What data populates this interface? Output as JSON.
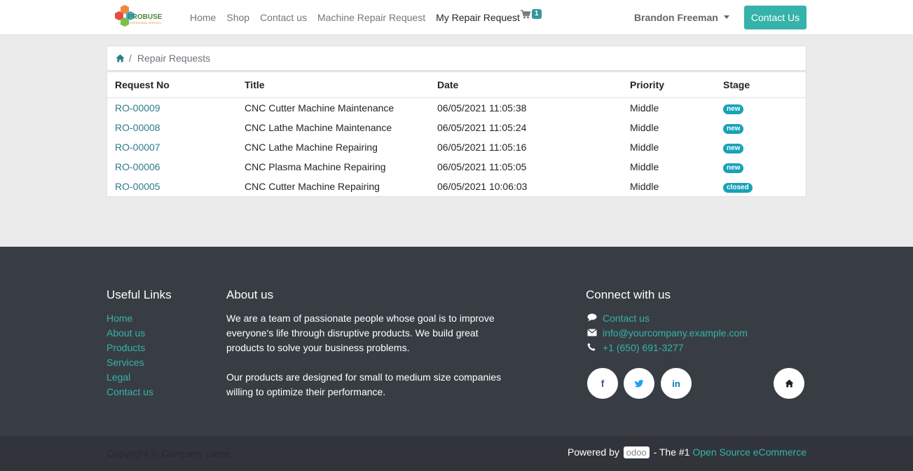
{
  "brand": {
    "name": "PROBUSE",
    "tagline": "PROFESSIONAL SERVICES"
  },
  "nav": {
    "items": [
      "Home",
      "Shop",
      "Contact us",
      "Machine Repair Request",
      "My Repair Request"
    ],
    "cart_count": "1",
    "user": "Brandon Freeman",
    "contact_button": "Contact Us"
  },
  "breadcrumb": {
    "current": "Repair Requests"
  },
  "table": {
    "headers": [
      "Request No",
      "Title",
      "Date",
      "Priority",
      "Stage"
    ],
    "rows": [
      {
        "no": "RO-00009",
        "title": "CNC Cutter Machine Maintenance",
        "date": "06/05/2021 11:05:38",
        "priority": "Middle",
        "stage": "new"
      },
      {
        "no": "RO-00008",
        "title": "CNC Lathe Machine Maintenance",
        "date": "06/05/2021 11:05:24",
        "priority": "Middle",
        "stage": "new"
      },
      {
        "no": "RO-00007",
        "title": "CNC Lathe Machine Repairing",
        "date": "06/05/2021 11:05:16",
        "priority": "Middle",
        "stage": "new"
      },
      {
        "no": "RO-00006",
        "title": "CNC Plasma Machine Repairing",
        "date": "06/05/2021 11:05:05",
        "priority": "Middle",
        "stage": "new"
      },
      {
        "no": "RO-00005",
        "title": "CNC Cutter Machine Repairing",
        "date": "06/05/2021 10:06:03",
        "priority": "Middle",
        "stage": "closed"
      }
    ]
  },
  "footer": {
    "useful_links_title": "Useful Links",
    "useful_links": [
      "Home",
      "About us",
      "Products",
      "Services",
      "Legal",
      "Contact us"
    ],
    "about_title": "About us",
    "about_p1": "We are a team of passionate people whose goal is to improve everyone's life through disruptive products. We build great products to solve your business problems.",
    "about_p2": "Our products are designed for small to medium size companies willing to optimize their performance.",
    "connect_title": "Connect with us",
    "connect_contact": "Contact us",
    "connect_email": "info@yourcompany.example.com",
    "connect_phone": "+1 (650) 691-3277",
    "social_facebook": "f",
    "social_linkedin": "in",
    "copyright": "Copyright © Company name",
    "powered_prefix": "Powered by",
    "odoo": "odoo",
    "powered_mid": "- The #1",
    "powered_link": "Open Source eCommerce"
  }
}
